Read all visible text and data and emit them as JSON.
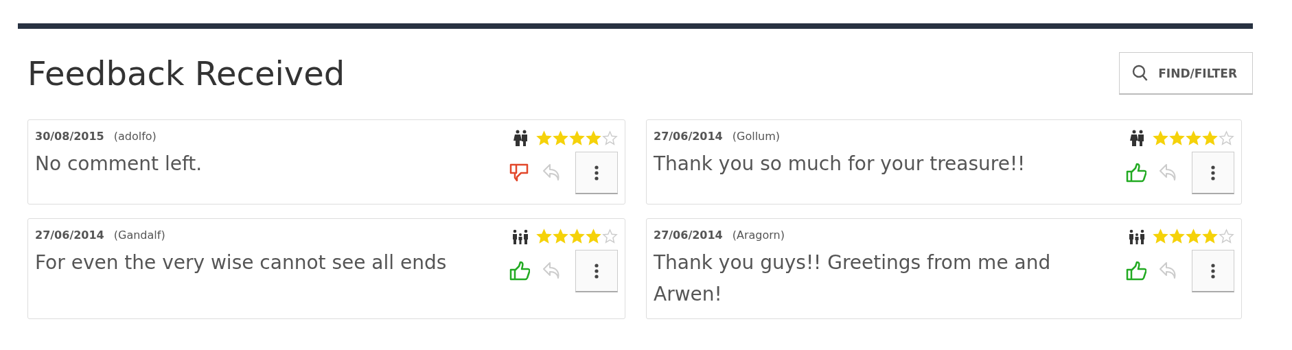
{
  "title": "Feedback Received",
  "filter_button": {
    "label": "FIND/FILTER"
  },
  "feedback": [
    {
      "date": "30/08/2015",
      "user": "(adolfo)",
      "comment": "No comment left.",
      "kind": "couple",
      "stars": 4,
      "liked": false
    },
    {
      "date": "27/06/2014",
      "user": "(Gollum)",
      "comment": "Thank you so much for your treasure!!",
      "kind": "couple",
      "stars": 4,
      "liked": true
    },
    {
      "date": "27/06/2014",
      "user": "(Gandalf)",
      "comment": "For even the very wise cannot see all ends",
      "kind": "group",
      "stars": 4,
      "liked": true
    },
    {
      "date": "27/06/2014",
      "user": "(Aragorn)",
      "comment": "Thank you guys!! Greetings from me and Arwen!",
      "kind": "group",
      "stars": 4,
      "liked": true
    }
  ]
}
